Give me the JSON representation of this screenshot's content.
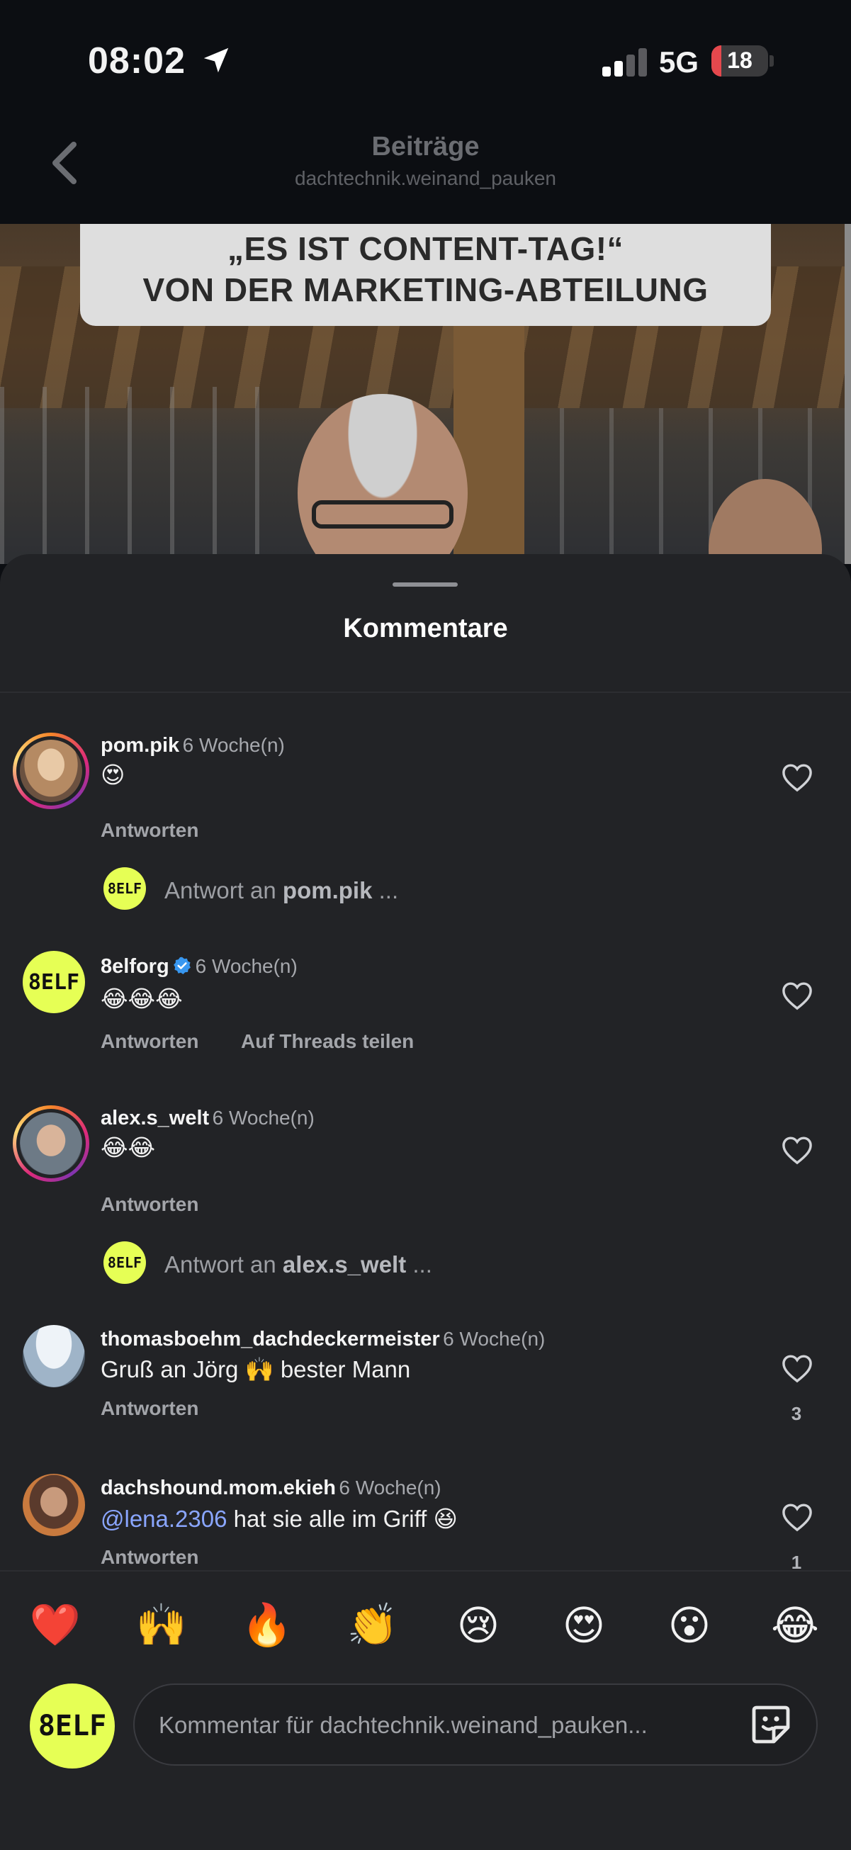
{
  "status_bar": {
    "time": "08:02",
    "network": "5G",
    "battery": "18"
  },
  "header": {
    "title": "Beiträge",
    "subtitle": "dachtechnik.weinand_pauken"
  },
  "video": {
    "overlay_line1": "„ES IST CONTENT-TAG!“",
    "overlay_line2": "VON DER MARKETING-ABTEILUNG"
  },
  "sheet": {
    "title": "Kommentare"
  },
  "comments": [
    {
      "username": "pom.pik",
      "time": "6 Woche(n)",
      "text": "😍",
      "reply_label": "Antworten",
      "reply_prompt_prefix": "Antwort an ",
      "reply_prompt_user": "pom.pik",
      "reply_prompt_suffix": " ..."
    },
    {
      "username": "8elforg",
      "verified": true,
      "time": "6 Woche(n)",
      "text": "😂😂😂",
      "reply_label": "Antworten",
      "share_label": "Auf Threads teilen",
      "avatar_text": "8ELF"
    },
    {
      "username": "alex.s_welt",
      "time": "6 Woche(n)",
      "text": "😂😂",
      "reply_label": "Antworten",
      "reply_prompt_prefix": "Antwort an ",
      "reply_prompt_user": "alex.s_welt",
      "reply_prompt_suffix": " ..."
    },
    {
      "username": "thomasboehm_dachdeckermeister",
      "time": "6 Woche(n)",
      "text": "Gruß an Jörg 🙌 bester Mann",
      "reply_label": "Antworten",
      "likes": "3"
    },
    {
      "username": "dachshound.mom.ekieh",
      "time": "6 Woche(n)",
      "mention": "@lena.2306",
      "text": " hat sie alle im Griff 😆",
      "reply_label": "Antworten",
      "likes": "1"
    }
  ],
  "reply_avatar_text": "8ELF",
  "emoji_bar": [
    "❤️",
    "🙌",
    "🔥",
    "👏",
    "😢",
    "😍",
    "😮",
    "😂"
  ],
  "composer": {
    "avatar_text": "8ELF",
    "placeholder": "Kommentar für dachtechnik.weinand_pauken..."
  },
  "colors": {
    "background": "#0c0e12",
    "sheet": "#222326",
    "brand_accent": "#e6ff55",
    "mention": "#8aa6ff",
    "verified": "#3897f0"
  }
}
